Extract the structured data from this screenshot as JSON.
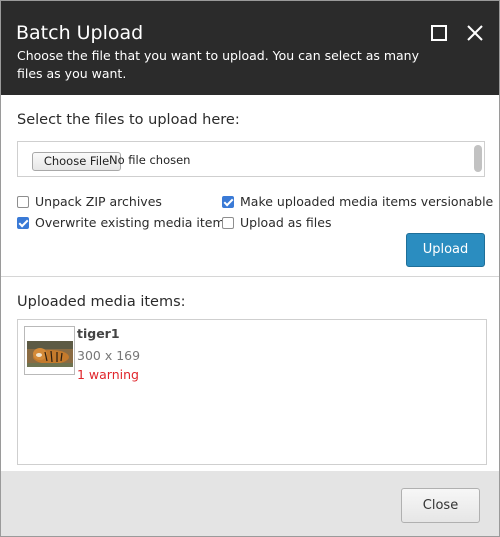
{
  "dialog": {
    "title": "Batch Upload",
    "subtitle": "Choose the file that you want to upload. You can select as many files as you want.",
    "maximize_icon": "maximize-icon",
    "close_icon": "close-icon"
  },
  "upload_section": {
    "label": "Select the files to upload here:",
    "choose_file_label": "Choose File",
    "no_file_text": "No file chosen"
  },
  "options": {
    "unpack_zip": {
      "label": "Unpack ZIP archives",
      "checked": false
    },
    "make_versionable": {
      "label": "Make uploaded media items versionable",
      "checked": true
    },
    "overwrite_existing": {
      "label": "Overwrite existing media items",
      "checked": true
    },
    "upload_as_files": {
      "label": "Upload as files",
      "checked": false
    }
  },
  "upload_button": {
    "label": "Upload",
    "color": "#2b8dc0"
  },
  "uploaded": {
    "label": "Uploaded media items:",
    "items": [
      {
        "name": "tiger1",
        "dimensions": "300 x 169",
        "warning": "1 warning"
      }
    ]
  },
  "footer": {
    "close_label": "Close"
  },
  "colors": {
    "header_bg": "#2b2b2b",
    "accent": "#2b8dc0",
    "warning": "#e0252b",
    "checkbox": "#3a7ad6"
  }
}
